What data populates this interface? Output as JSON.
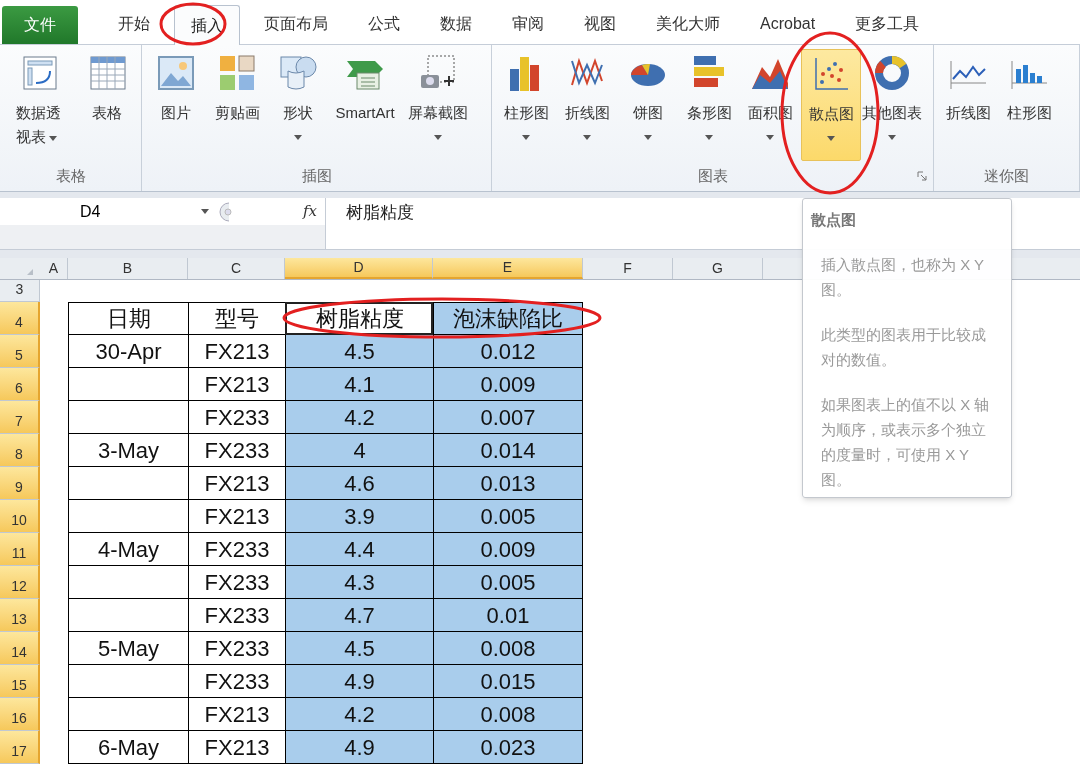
{
  "tabs": [
    {
      "label": "文件",
      "kind": "file",
      "selected": false
    },
    {
      "label": "开始",
      "kind": "tab",
      "selected": false
    },
    {
      "label": "插入",
      "kind": "tab",
      "selected": true
    },
    {
      "label": "页面布局",
      "kind": "tab",
      "selected": false
    },
    {
      "label": "公式",
      "kind": "tab",
      "selected": false
    },
    {
      "label": "数据",
      "kind": "tab",
      "selected": false
    },
    {
      "label": "审阅",
      "kind": "tab",
      "selected": false
    },
    {
      "label": "视图",
      "kind": "tab",
      "selected": false
    },
    {
      "label": "美化大师",
      "kind": "tab",
      "selected": false
    },
    {
      "label": "Acrobat",
      "kind": "tab",
      "selected": false
    },
    {
      "label": "更多工具",
      "kind": "tab",
      "selected": false
    }
  ],
  "ribbon_groups": [
    {
      "label": "表格",
      "launcher": false,
      "items": [
        {
          "label": "数据透视表",
          "kind": "pivot",
          "dropdown": true,
          "selected": false
        },
        {
          "label": "表格",
          "kind": "table",
          "dropdown": false,
          "selected": false
        }
      ]
    },
    {
      "label": "插图",
      "launcher": false,
      "items": [
        {
          "label": "图片",
          "kind": "picture",
          "dropdown": false,
          "selected": false
        },
        {
          "label": "剪贴画",
          "kind": "clipart",
          "dropdown": false,
          "selected": false
        },
        {
          "label": "形状",
          "kind": "shapes",
          "dropdown": true,
          "selected": false
        },
        {
          "label": "SmartArt",
          "kind": "smartart",
          "dropdown": false,
          "selected": false
        },
        {
          "label": "屏幕截图",
          "kind": "screenshot",
          "dropdown": true,
          "selected": false
        }
      ]
    },
    {
      "label": "图表",
      "launcher": true,
      "items": [
        {
          "label": "柱形图",
          "kind": "column",
          "dropdown": true,
          "selected": false
        },
        {
          "label": "折线图",
          "kind": "line",
          "dropdown": true,
          "selected": false
        },
        {
          "label": "饼图",
          "kind": "pie",
          "dropdown": true,
          "selected": false
        },
        {
          "label": "条形图",
          "kind": "bar",
          "dropdown": true,
          "selected": false
        },
        {
          "label": "面积图",
          "kind": "area",
          "dropdown": true,
          "selected": false
        },
        {
          "label": "散点图",
          "kind": "scatter",
          "dropdown": true,
          "selected": true
        },
        {
          "label": "其他图表",
          "kind": "other",
          "dropdown": true,
          "selected": false
        }
      ]
    },
    {
      "label": "迷你图",
      "launcher": false,
      "items": [
        {
          "label": "折线图",
          "kind": "spark-line",
          "dropdown": false,
          "selected": false
        },
        {
          "label": "柱形图",
          "kind": "spark-column",
          "dropdown": false,
          "selected": false
        }
      ]
    }
  ],
  "formula_bar": {
    "name_box": "D4",
    "fx": "fx",
    "formula": "树脂粘度"
  },
  "columns": [
    {
      "label": "A",
      "selected": false
    },
    {
      "label": "B",
      "selected": false
    },
    {
      "label": "C",
      "selected": false
    },
    {
      "label": "D",
      "selected": true
    },
    {
      "label": "E",
      "selected": true
    },
    {
      "label": "F",
      "selected": false
    },
    {
      "label": "G",
      "selected": false
    }
  ],
  "empty_rows": [
    {
      "row": "3",
      "selected": false
    }
  ],
  "table": {
    "rows": [
      {
        "row": "4",
        "selected": true,
        "date": "日期",
        "model": "型号",
        "viscosity": "树脂粘度",
        "defect_ratio": "泡沫缺陷比"
      },
      {
        "row": "5",
        "selected": true,
        "date": "30-Apr",
        "model": "FX213",
        "viscosity": "4.5",
        "defect_ratio": "0.012"
      },
      {
        "row": "6",
        "selected": true,
        "model": "FX213",
        "viscosity": "4.1",
        "defect_ratio": "0.009"
      },
      {
        "row": "7",
        "selected": true,
        "model": "FX233",
        "viscosity": "4.2",
        "defect_ratio": "0.007"
      },
      {
        "row": "8",
        "selected": true,
        "date": "3-May",
        "model": "FX233",
        "viscosity": "4",
        "defect_ratio": "0.014"
      },
      {
        "row": "9",
        "selected": true,
        "model": "FX213",
        "viscosity": "4.6",
        "defect_ratio": "0.013"
      },
      {
        "row": "10",
        "selected": true,
        "model": "FX213",
        "viscosity": "3.9",
        "defect_ratio": "0.005"
      },
      {
        "row": "11",
        "selected": true,
        "date": "4-May",
        "model": "FX233",
        "viscosity": "4.4",
        "defect_ratio": "0.009"
      },
      {
        "row": "12",
        "selected": true,
        "model": "FX233",
        "viscosity": "4.3",
        "defect_ratio": "0.005"
      },
      {
        "row": "13",
        "selected": true,
        "model": "FX233",
        "viscosity": "4.7",
        "defect_ratio": "0.01"
      },
      {
        "row": "14",
        "selected": true,
        "date": "5-May",
        "model": "FX233",
        "viscosity": "4.5",
        "defect_ratio": "0.008"
      },
      {
        "row": "15",
        "selected": true,
        "model": "FX233",
        "viscosity": "4.9",
        "defect_ratio": "0.015"
      },
      {
        "row": "16",
        "selected": true,
        "model": "FX213",
        "viscosity": "4.2",
        "defect_ratio": "0.008"
      },
      {
        "row": "17",
        "selected": true,
        "date": "6-May",
        "model": "FX213",
        "viscosity": "4.9",
        "defect_ratio": "0.023"
      }
    ]
  },
  "tooltip": {
    "title": "散点图",
    "paragraphs": [
      "插入散点图，也称为 X Y 图。",
      "此类型的图表用于比较成对的数值。",
      "如果图表上的值不以 X 轴为顺序，或表示多个独立的度量时，可使用 X Y 图。"
    ]
  }
}
